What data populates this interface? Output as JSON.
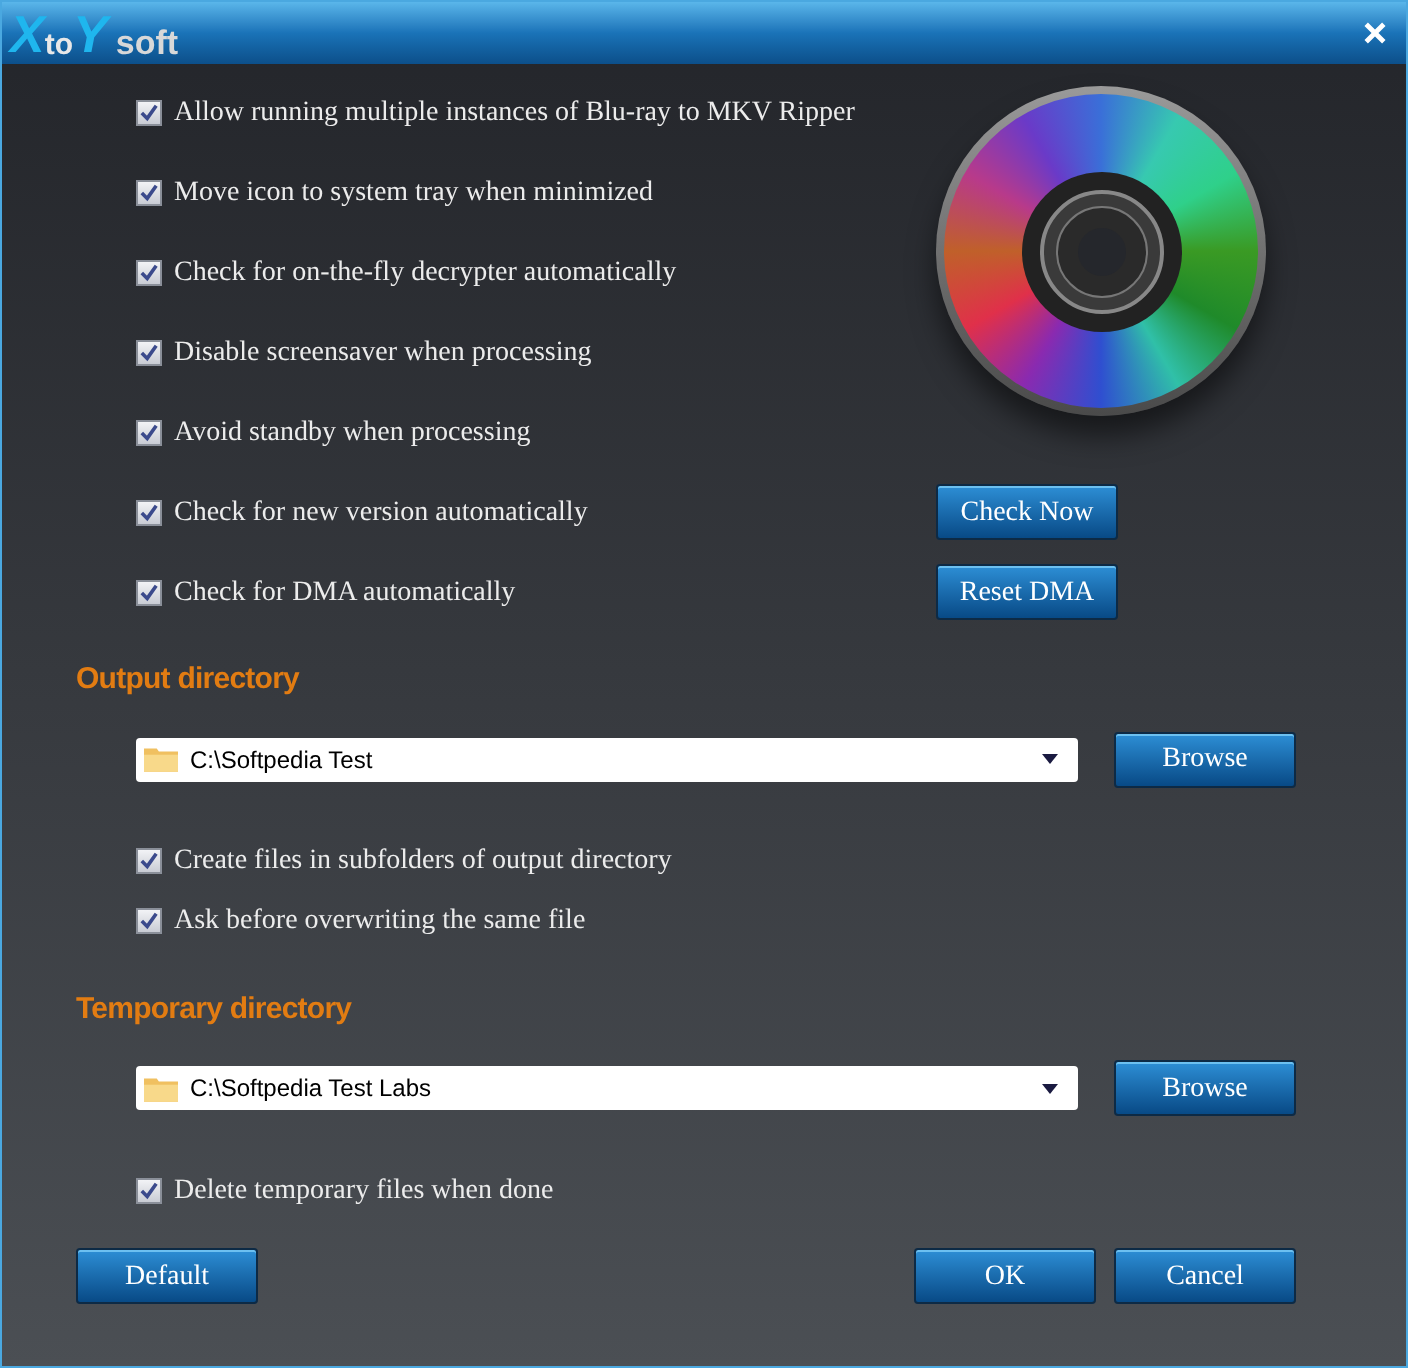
{
  "logo": [
    "X",
    "to",
    "Y",
    "soft"
  ],
  "options": [
    {
      "label": "Allow running multiple instances of Blu-ray to MKV Ripper",
      "checked": true
    },
    {
      "label": "Move icon to system tray when minimized",
      "checked": true
    },
    {
      "label": "Check for on-the-fly decrypter automatically",
      "checked": true
    },
    {
      "label": "Disable screensaver when processing",
      "checked": true
    },
    {
      "label": "Avoid standby when processing",
      "checked": true
    },
    {
      "label": "Check for new version automatically",
      "checked": true,
      "button": "Check Now"
    },
    {
      "label": "Check for DMA automatically",
      "checked": true,
      "button": "Reset DMA"
    }
  ],
  "directories": [
    {
      "heading": "Output directory",
      "path": "C:\\Softpedia Test",
      "button": "Browse",
      "options": [
        {
          "label": "Create files in subfolders of output directory",
          "checked": true
        },
        {
          "label": "Ask before overwriting the same file",
          "checked": true
        }
      ]
    },
    {
      "heading": "Temporary directory",
      "path": "C:\\Softpedia Test Labs",
      "button": "Browse",
      "options": [
        {
          "label": "Delete temporary files when done",
          "checked": true
        }
      ]
    }
  ],
  "footer": {
    "left": "Default",
    "right": [
      "OK",
      "Cancel"
    ]
  }
}
